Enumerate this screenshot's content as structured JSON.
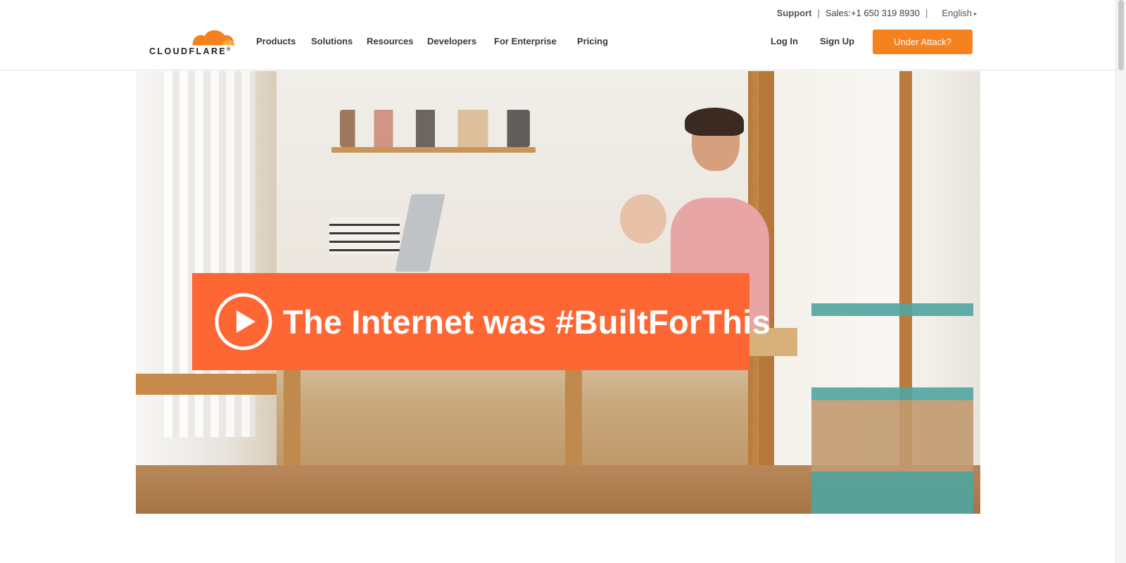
{
  "utility": {
    "support": "Support",
    "separator": "|",
    "sales": "Sales:+1 650 319 8930",
    "language": "English",
    "language_caret": "▸"
  },
  "brand": {
    "logo_text": "CLOUDFLARE",
    "logo_mark": "®",
    "color_orange": "#f6821f",
    "color_light_orange": "#fbad41"
  },
  "nav": {
    "items": [
      "Products",
      "Solutions",
      "Resources",
      "Developers",
      "For Enterprise",
      "Pricing"
    ]
  },
  "account": {
    "login": "Log In",
    "signup": "Sign Up",
    "under_attack": "Under Attack?"
  },
  "hero": {
    "banner_text": "The Internet was #BuiltForThis",
    "banner_color": "#fe6634",
    "play_icon": "play-circle-icon"
  }
}
